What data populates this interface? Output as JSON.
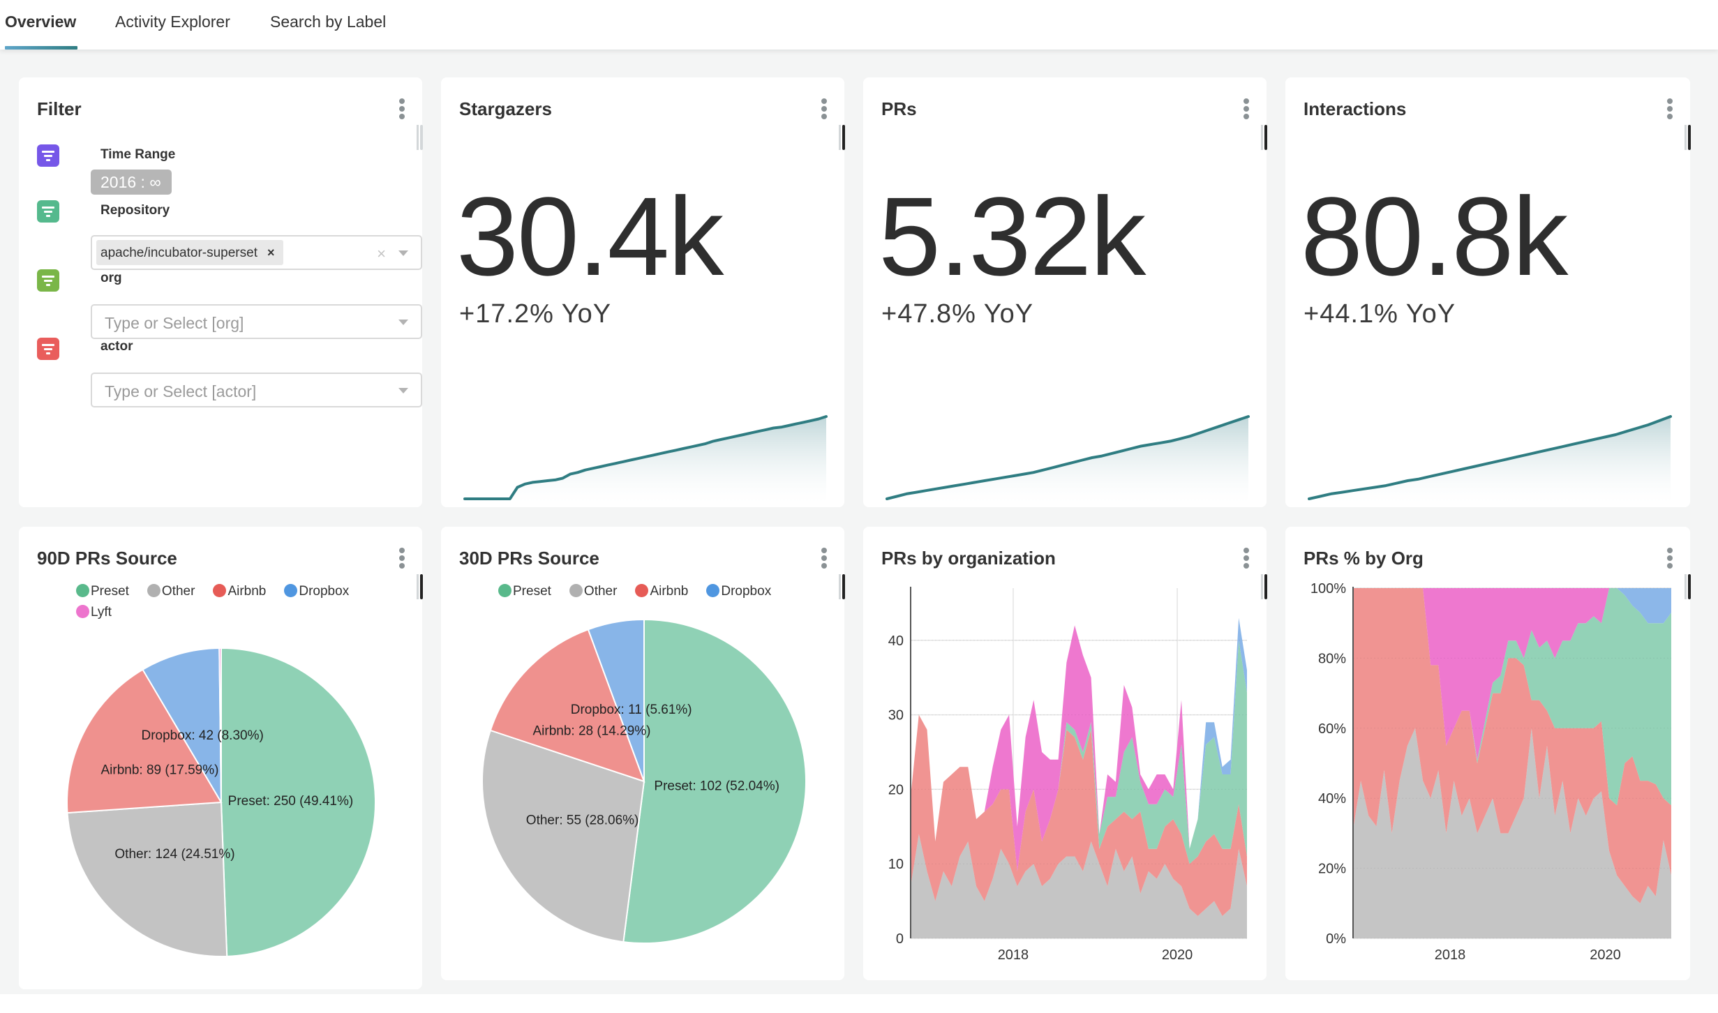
{
  "tabs": [
    {
      "label": "Overview",
      "active": true
    },
    {
      "label": "Activity Explorer",
      "active": false
    },
    {
      "label": "Search by Label",
      "active": false
    }
  ],
  "colors": {
    "accent": "#2f7d82",
    "preset": "#8fd1b5",
    "other": "#c3c3c3",
    "airbnb": "#ef918e",
    "dropbox": "#88b5e8",
    "lyft": "#ed74cd",
    "legend_preset": "#59b98b",
    "legend_other": "#b0b0b0",
    "legend_airbnb": "#e65b56",
    "legend_dropbox": "#4f96e0",
    "legend_lyft": "#ed74cd"
  },
  "filter": {
    "title": "Filter",
    "items": [
      {
        "label": "Time Range",
        "icon": "filter-icon",
        "color": "#7657e8",
        "value": "2016 : ∞"
      },
      {
        "label": "Repository",
        "icon": "filter-icon",
        "color": "#55b98d",
        "tag": "apache/incubator-superset",
        "tag_remove": "×",
        "clear": "×"
      },
      {
        "label": "org",
        "icon": "filter-icon",
        "color": "#7ab648",
        "placeholder": "Type or Select [org]"
      },
      {
        "label": "actor",
        "icon": "filter-icon",
        "color": "#e95d5c",
        "placeholder": "Type or Select [actor]"
      }
    ]
  },
  "kpis": [
    {
      "title": "Stargazers",
      "value": "30.4k",
      "yoy": "+17.2% YoY",
      "trend": [
        0.0,
        0.0,
        0.0,
        0.0,
        0.0,
        0.0,
        0.0,
        0.14,
        0.18,
        0.2,
        0.21,
        0.22,
        0.23,
        0.25,
        0.3,
        0.32,
        0.35,
        0.37,
        0.39,
        0.41,
        0.43,
        0.45,
        0.47,
        0.49,
        0.51,
        0.53,
        0.55,
        0.57,
        0.59,
        0.61,
        0.63,
        0.65,
        0.67,
        0.7,
        0.72,
        0.74,
        0.76,
        0.78,
        0.8,
        0.82,
        0.84,
        0.86,
        0.87,
        0.89,
        0.91,
        0.93,
        0.95,
        0.97,
        1.0
      ]
    },
    {
      "title": "PRs",
      "value": "5.32k",
      "yoy": "+47.8% YoY",
      "trend": [
        0.0,
        0.03,
        0.06,
        0.08,
        0.1,
        0.12,
        0.14,
        0.16,
        0.18,
        0.2,
        0.22,
        0.24,
        0.26,
        0.28,
        0.3,
        0.32,
        0.35,
        0.38,
        0.41,
        0.44,
        0.47,
        0.5,
        0.52,
        0.55,
        0.58,
        0.61,
        0.64,
        0.66,
        0.68,
        0.7,
        0.73,
        0.76,
        0.8,
        0.84,
        0.88,
        0.92,
        0.96,
        1.0
      ]
    },
    {
      "title": "Interactions",
      "value": "80.8k",
      "yoy": "+44.1% YoY",
      "trend": [
        0.0,
        0.03,
        0.06,
        0.08,
        0.1,
        0.12,
        0.14,
        0.16,
        0.19,
        0.22,
        0.24,
        0.27,
        0.3,
        0.33,
        0.36,
        0.39,
        0.42,
        0.45,
        0.48,
        0.51,
        0.54,
        0.57,
        0.6,
        0.63,
        0.66,
        0.69,
        0.72,
        0.75,
        0.78,
        0.82,
        0.86,
        0.9,
        0.95,
        1.0
      ]
    }
  ],
  "chart_data": [
    {
      "type": "pie",
      "title": "90D PRs Source",
      "legend": [
        "Preset",
        "Other",
        "Airbnb",
        "Dropbox",
        "Lyft"
      ],
      "legend_position": "top",
      "slices": [
        {
          "name": "Preset",
          "value": 250,
          "percent": "49.41%",
          "label": "Preset: 250 (49.41%)"
        },
        {
          "name": "Other",
          "value": 124,
          "percent": "24.51%",
          "label": "Other: 124 (24.51%)"
        },
        {
          "name": "Airbnb",
          "value": 89,
          "percent": "17.59%",
          "label": "Airbnb: 89 (17.59%)"
        },
        {
          "name": "Dropbox",
          "value": 42,
          "percent": "8.30%",
          "label": "Dropbox: 42 (8.30%)"
        },
        {
          "name": "Lyft",
          "value": 1,
          "percent": "0.20%",
          "label": ""
        }
      ]
    },
    {
      "type": "pie",
      "title": "30D PRs Source",
      "legend": [
        "Preset",
        "Other",
        "Airbnb",
        "Dropbox"
      ],
      "legend_position": "top",
      "slices": [
        {
          "name": "Preset",
          "value": 102,
          "percent": "52.04%",
          "label": "Preset: 102 (52.04%)"
        },
        {
          "name": "Other",
          "value": 55,
          "percent": "28.06%",
          "label": "Other: 55 (28.06%)"
        },
        {
          "name": "Airbnb",
          "value": 28,
          "percent": "14.29%",
          "label": "Airbnb: 28 (14.29%)"
        },
        {
          "name": "Dropbox",
          "value": 11,
          "percent": "5.61%",
          "label": "Dropbox: 11 (5.61%)"
        }
      ]
    },
    {
      "type": "area",
      "stacked": true,
      "title": "PRs by organization",
      "xlabel": "",
      "ylabel": "",
      "xlim": [
        2016.75,
        2020.85
      ],
      "ylim": [
        0,
        47
      ],
      "yticks": [
        "0",
        "10",
        "20",
        "30",
        "40"
      ],
      "xticks": [
        {
          "value": 2018,
          "label": "2018"
        },
        {
          "value": 2020,
          "label": "2020"
        }
      ],
      "grid": true,
      "x": [
        2016.75,
        2016.85,
        2016.95,
        2017.05,
        2017.15,
        2017.25,
        2017.35,
        2017.45,
        2017.55,
        2017.65,
        2017.75,
        2017.85,
        2017.95,
        2018.05,
        2018.15,
        2018.25,
        2018.35,
        2018.45,
        2018.55,
        2018.65,
        2018.75,
        2018.85,
        2018.95,
        2019.05,
        2019.15,
        2019.25,
        2019.35,
        2019.45,
        2019.55,
        2019.65,
        2019.75,
        2019.85,
        2019.95,
        2020.05,
        2020.15,
        2020.25,
        2020.35,
        2020.45,
        2020.55,
        2020.65,
        2020.75,
        2020.85
      ],
      "series": [
        {
          "name": "Other",
          "values": [
            7,
            14,
            9,
            5,
            9,
            7,
            11,
            13,
            7,
            5,
            8,
            12,
            10,
            7,
            9,
            10,
            7,
            8,
            10,
            11,
            11,
            9,
            13,
            10,
            7,
            12,
            9,
            11,
            6,
            9,
            8,
            10,
            8,
            7,
            4,
            3,
            4,
            5,
            3,
            4,
            12,
            7
          ]
        },
        {
          "name": "Airbnb",
          "values": [
            12,
            16,
            19,
            8,
            12,
            15,
            12,
            10,
            9,
            12,
            10,
            8,
            10,
            2,
            8,
            10,
            6,
            8,
            10,
            17,
            16,
            15,
            15,
            2,
            8,
            4,
            8,
            5,
            11,
            3,
            4,
            5,
            8,
            7,
            6,
            8,
            9,
            9,
            9,
            8,
            6,
            4
          ]
        },
        {
          "name": "Preset",
          "values": [
            0,
            0,
            0,
            0,
            0,
            0,
            0,
            0,
            0,
            0,
            0,
            0,
            0,
            0,
            0,
            0,
            0,
            0,
            0,
            1,
            1,
            1,
            1,
            2,
            4,
            3,
            8,
            11,
            4,
            6,
            6,
            5,
            3,
            12,
            2,
            5,
            13,
            13,
            10,
            10,
            22,
            22
          ]
        },
        {
          "name": "Lyft",
          "values": [
            0,
            0,
            0,
            0,
            0,
            0,
            0,
            0,
            0,
            0,
            5,
            8,
            10,
            6,
            10,
            12,
            12,
            8,
            4,
            8,
            14,
            13,
            6,
            0,
            3,
            2,
            9,
            4,
            1,
            2,
            4,
            2,
            1,
            6,
            0,
            0,
            0,
            0,
            0,
            0,
            0,
            0
          ]
        },
        {
          "name": "Dropbox",
          "values": [
            0,
            0,
            0,
            0,
            0,
            0,
            0,
            0,
            0,
            0,
            0,
            0,
            0,
            0,
            0,
            0,
            0,
            0,
            0,
            0,
            0,
            0,
            0,
            0,
            0,
            0,
            0,
            0,
            0,
            0,
            0,
            0,
            0,
            0,
            0,
            0,
            3,
            2,
            1,
            2,
            3,
            3
          ]
        }
      ]
    },
    {
      "type": "area",
      "stacked": true,
      "percent": true,
      "title": "PRs % by Org",
      "xlim": [
        2016.75,
        2020.85
      ],
      "ylim": [
        0,
        100
      ],
      "yticks": [
        "0%",
        "20%",
        "40%",
        "60%",
        "80%",
        "100%"
      ],
      "xticks": [
        {
          "value": 2018,
          "label": "2018"
        },
        {
          "value": 2020,
          "label": "2020"
        }
      ],
      "grid": true,
      "x": [
        2016.75,
        2016.85,
        2016.95,
        2017.05,
        2017.15,
        2017.25,
        2017.35,
        2017.45,
        2017.55,
        2017.65,
        2017.75,
        2017.85,
        2017.95,
        2018.05,
        2018.15,
        2018.25,
        2018.35,
        2018.45,
        2018.55,
        2018.65,
        2018.75,
        2018.85,
        2018.95,
        2019.05,
        2019.15,
        2019.25,
        2019.35,
        2019.45,
        2019.55,
        2019.65,
        2019.75,
        2019.85,
        2019.95,
        2020.05,
        2020.15,
        2020.25,
        2020.35,
        2020.45,
        2020.55,
        2020.65,
        2020.75,
        2020.85
      ],
      "series": [
        {
          "name": "Other",
          "values": [
            31,
            45,
            35,
            32,
            48,
            30,
            45,
            55,
            60,
            45,
            40,
            48,
            30,
            45,
            35,
            40,
            30,
            35,
            40,
            30,
            30,
            35,
            40,
            60,
            40,
            55,
            35,
            45,
            30,
            40,
            35,
            40,
            42,
            25,
            18,
            15,
            12,
            10,
            15,
            12,
            28,
            18
          ]
        },
        {
          "name": "Airbnb",
          "values": [
            69,
            55,
            65,
            68,
            52,
            70,
            55,
            45,
            40,
            55,
            38,
            30,
            25,
            15,
            30,
            25,
            20,
            25,
            30,
            40,
            50,
            45,
            38,
            8,
            28,
            10,
            25,
            15,
            30,
            20,
            25,
            20,
            20,
            15,
            20,
            35,
            40,
            35,
            30,
            32,
            12,
            20
          ]
        },
        {
          "name": "Preset",
          "values": [
            0,
            0,
            0,
            0,
            0,
            0,
            0,
            0,
            0,
            0,
            0,
            0,
            0,
            0,
            0,
            0,
            1,
            2,
            3,
            5,
            5,
            5,
            2,
            20,
            15,
            20,
            20,
            25,
            25,
            30,
            30,
            32,
            28,
            60,
            62,
            48,
            43,
            48,
            45,
            46,
            50,
            55
          ]
        },
        {
          "name": "Lyft",
          "values": [
            0,
            0,
            0,
            0,
            0,
            0,
            0,
            0,
            0,
            0,
            22,
            22,
            45,
            40,
            35,
            35,
            49,
            38,
            27,
            25,
            15,
            15,
            20,
            12,
            17,
            15,
            20,
            15,
            15,
            10,
            10,
            8,
            10,
            0,
            0,
            0,
            0,
            0,
            0,
            0,
            0,
            0
          ]
        },
        {
          "name": "Dropbox",
          "values": [
            0,
            0,
            0,
            0,
            0,
            0,
            0,
            0,
            0,
            0,
            0,
            0,
            0,
            0,
            0,
            0,
            0,
            0,
            0,
            0,
            0,
            0,
            0,
            0,
            0,
            0,
            0,
            0,
            0,
            0,
            0,
            0,
            0,
            0,
            0,
            2,
            5,
            7,
            10,
            10,
            10,
            7
          ]
        }
      ]
    }
  ]
}
